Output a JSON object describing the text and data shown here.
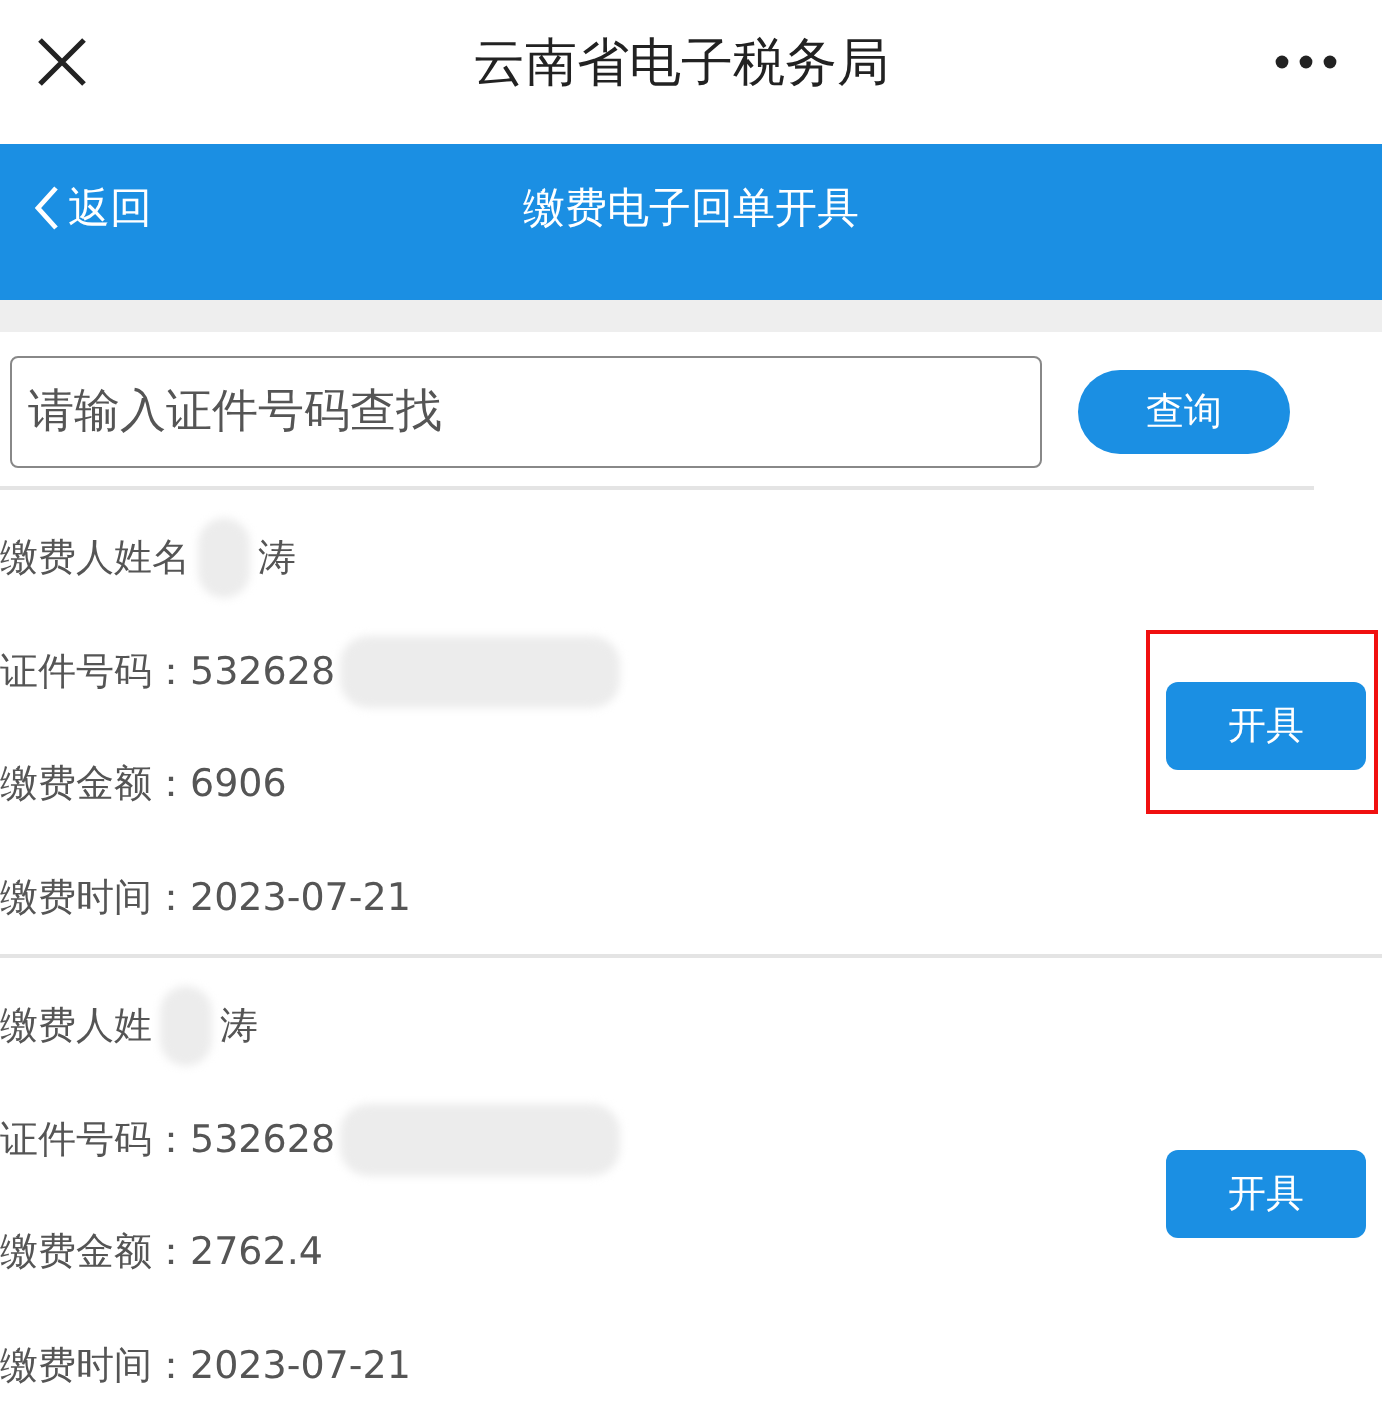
{
  "top_bar": {
    "title": "云南省电子税务局"
  },
  "header": {
    "back": "返回",
    "title": "缴费电子回单开具"
  },
  "search": {
    "placeholder": "请输入证件号码查找",
    "button": "查询"
  },
  "records": [
    {
      "highlighted": true,
      "button": "开具",
      "fields": [
        {
          "kind": "redacted_gap",
          "label": "缴费人姓名",
          "value": "涛"
        },
        {
          "kind": "redacted_tail",
          "label": "证件号码：",
          "value": "532628"
        },
        {
          "kind": "plain",
          "label": "缴费金额：",
          "value": "6906"
        },
        {
          "kind": "plain",
          "label": "缴费时间：",
          "value": "2023-07-21"
        }
      ]
    },
    {
      "highlighted": false,
      "button": "开具",
      "fields": [
        {
          "kind": "redacted_gap",
          "label": "缴费人姓",
          "value": "涛"
        },
        {
          "kind": "redacted_tail",
          "label": "证件号码：",
          "value": "532628"
        },
        {
          "kind": "plain",
          "label": "缴费金额：",
          "value": "2762.4"
        },
        {
          "kind": "plain",
          "label": "缴费时间：",
          "value": "2023-07-21"
        }
      ]
    }
  ]
}
